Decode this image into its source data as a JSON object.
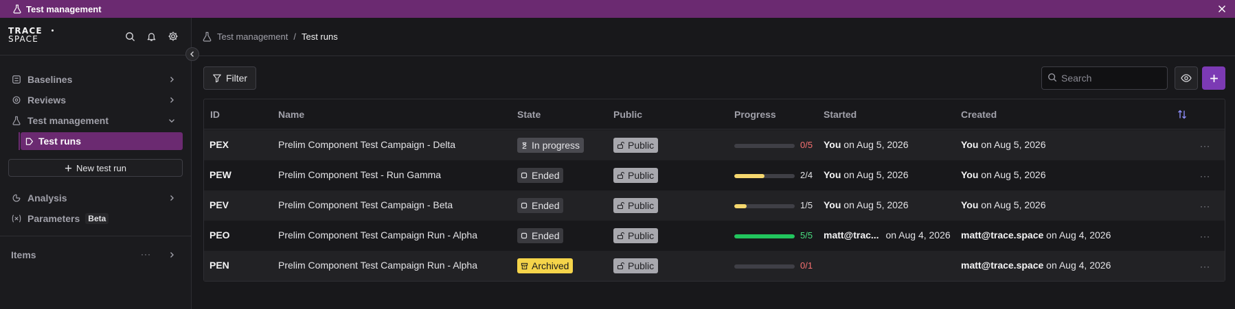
{
  "titlebar": {
    "title": "Test management"
  },
  "sidebar": {
    "logo_line1": "TRACE",
    "logo_line2": "SPACE",
    "nav": [
      {
        "label": "Baselines"
      },
      {
        "label": "Reviews"
      },
      {
        "label": "Test management"
      },
      {
        "label": "Test runs"
      },
      {
        "label": "Analysis"
      },
      {
        "label": "Parameters"
      }
    ],
    "new_run_label": "New test run",
    "beta_label": "Beta",
    "items_label": "Items",
    "items_more": "···"
  },
  "breadcrumb": {
    "root": "Test management",
    "separator": "/",
    "current": "Test runs"
  },
  "toolbar": {
    "filter_label": "Filter",
    "search_placeholder": "Search"
  },
  "table": {
    "columns": [
      "ID",
      "Name",
      "State",
      "Public",
      "Progress",
      "Started",
      "Created"
    ],
    "rows": [
      {
        "id": "PEX",
        "name": "Prelim Component Test Campaign - Delta",
        "state": "In progress",
        "public": "Public",
        "progress_text": "0/5",
        "progress": 0.0,
        "started_by": "You",
        "started_on": "on Aug 5, 2026",
        "created_by": "You",
        "created_on": "on Aug 5, 2026",
        "more": "···"
      },
      {
        "id": "PEW",
        "name": "Prelim Component Test - Run Gamma",
        "state": "Ended",
        "public": "Public",
        "progress_text": "2/4",
        "progress": 0.5,
        "started_by": "You",
        "started_on": "on Aug 5, 2026",
        "created_by": "You",
        "created_on": "on Aug 5, 2026",
        "more": "···"
      },
      {
        "id": "PEV",
        "name": "Prelim Component Test Campaign - Beta",
        "state": "Ended",
        "public": "Public",
        "progress_text": "1/5",
        "progress": 0.2,
        "started_by": "You",
        "started_on": "on Aug 5, 2026",
        "created_by": "You",
        "created_on": "on Aug 5, 2026",
        "more": "···"
      },
      {
        "id": "PEO",
        "name": "Prelim Component Test Campaign Run - Alpha",
        "state": "Ended",
        "public": "Public",
        "progress_text": "5/5",
        "progress": 1.0,
        "started_by": "matt@trac...",
        "started_on": "on Aug 4, 2026",
        "created_by": "matt@trace.space",
        "created_on": "on Aug 4, 2026",
        "more": "···"
      },
      {
        "id": "PEN",
        "name": "Prelim Component Test Campaign Run - Alpha",
        "state": "Archived",
        "public": "Public",
        "progress_text": "0/1",
        "progress": 0.0,
        "started_by": "",
        "started_on": "",
        "created_by": "matt@trace.space",
        "created_on": "on Aug 4, 2026",
        "more": "···"
      }
    ]
  },
  "colors": {
    "brand": "#6b2a71",
    "accent": "#7c3ab4",
    "progress_partial": "#f5d76e",
    "progress_complete": "#22c55e",
    "progress_none": "#f87171",
    "archived": "#f5d44a"
  }
}
